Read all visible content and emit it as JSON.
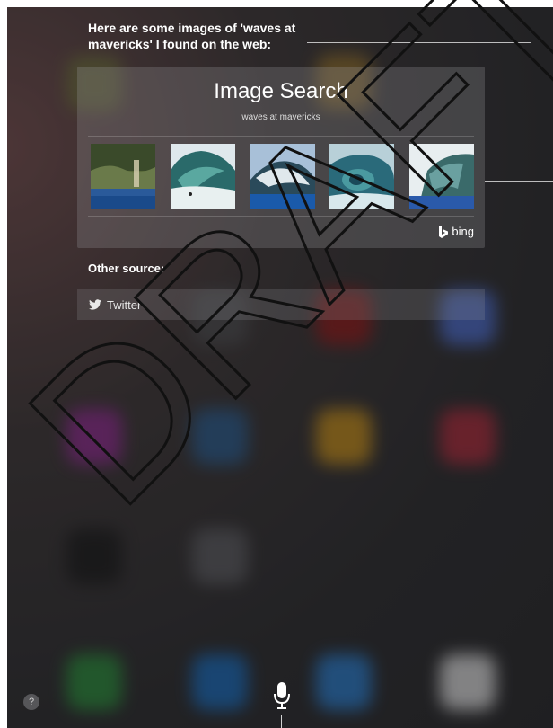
{
  "siri": {
    "heading": "Here are some images of 'waves at mavericks' I found on the web:"
  },
  "image_search": {
    "title": "Image Search",
    "query": "waves at mavericks",
    "thumbnails": [
      {
        "icon": "wave-photo-1"
      },
      {
        "icon": "wave-photo-2"
      },
      {
        "icon": "wave-photo-3"
      },
      {
        "icon": "wave-photo-4"
      },
      {
        "icon": "wave-photo-5"
      }
    ],
    "provider": "bing"
  },
  "other_source": {
    "label": "Other source:",
    "items": [
      {
        "label": "Twitter",
        "icon": "twitter-icon"
      }
    ]
  },
  "controls": {
    "help_label": "?",
    "mic_icon": "microphone-icon"
  },
  "watermark": {
    "text": "DRAFT"
  },
  "colors": {
    "accent_text": "#ffffff",
    "card_bg": "rgba(150,150,155,0.28)",
    "twitter_blue": "#ffffff"
  }
}
